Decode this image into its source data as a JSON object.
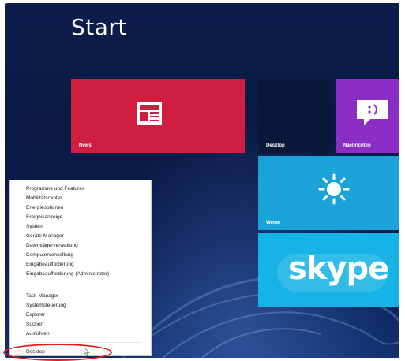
{
  "start_screen": {
    "title": "Start"
  },
  "tiles": {
    "news": {
      "label": "News",
      "color": "#d01e40",
      "icon": "newspaper-icon"
    },
    "desktop": {
      "label": "Desktop",
      "color": "#091838"
    },
    "nachrichten": {
      "label": "Nachrichten",
      "color": "#8a2ec5",
      "icon": "chat-bubble-icon"
    },
    "wetter": {
      "label": "Wetter",
      "color": "#1aa3d9",
      "icon": "sun-icon"
    },
    "skype": {
      "label": "skype",
      "color": "#18b3e6"
    }
  },
  "context_menu": {
    "items": [
      {
        "label": "Programme und Features"
      },
      {
        "label": "Mobilitätscenter"
      },
      {
        "label": "Energieoptionen"
      },
      {
        "label": "Ereignisanzeige"
      },
      {
        "label": "System"
      },
      {
        "label": "Geräte-Manager"
      },
      {
        "label": "Datenträgerverwaltung"
      },
      {
        "label": "Computerverwaltung"
      },
      {
        "label": "Eingabeaufforderung"
      },
      {
        "label": "Eingabeaufforderung (Administrator)"
      },
      {
        "label": "Task-Manager"
      },
      {
        "label": "Systemsteuerung"
      },
      {
        "label": "Explorer"
      },
      {
        "label": "Suchen"
      },
      {
        "label": "Ausführen"
      },
      {
        "label": "Desktop"
      }
    ]
  },
  "annotation": {
    "highlight_color": "#e21a1a"
  }
}
